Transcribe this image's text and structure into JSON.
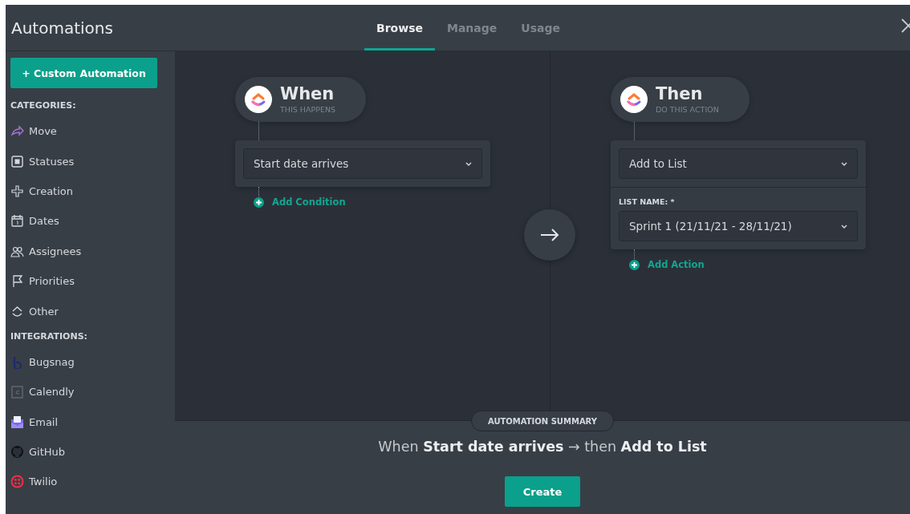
{
  "header": {
    "title": "Automations",
    "tabs": [
      {
        "label": "Browse",
        "selected": true
      },
      {
        "label": "Manage",
        "selected": false
      },
      {
        "label": "Usage",
        "selected": false
      }
    ]
  },
  "sidebar": {
    "button": "+ Custom Automation",
    "sections": [
      {
        "heading": "CATEGORIES:",
        "items": [
          "Move",
          "Statuses",
          "Creation",
          "Dates",
          "Assignees",
          "Priorities",
          "Other"
        ]
      },
      {
        "heading": "INTEGRATIONS:",
        "items": [
          "Bugsnag",
          "Calendly",
          "Email",
          "GitHub",
          "Twilio"
        ]
      }
    ]
  },
  "steps": [
    {
      "title": "When",
      "subtitle": "THIS HAPPENS",
      "fields": [
        {
          "value": "Start date arrives"
        }
      ],
      "add_link": "Add Condition"
    },
    {
      "title": "Then",
      "subtitle": "DO THIS ACTION",
      "fields": [
        {
          "value": "Add to List"
        },
        {
          "label": "LIST NAME: *",
          "value": "Sprint 1 (21/11/21 - 28/11/21)"
        }
      ],
      "add_link": "Add Action"
    }
  ],
  "summary": {
    "badge": "AUTOMATION SUMMARY",
    "sentence": "When **Start date arrives** → then **Add to List**",
    "button": "Create"
  }
}
